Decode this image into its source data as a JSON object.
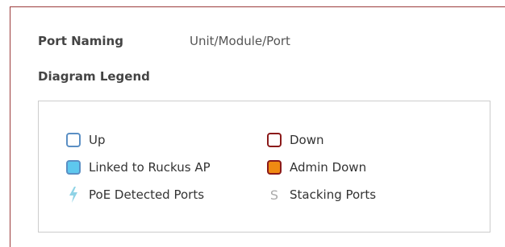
{
  "port_naming": {
    "label": "Port Naming",
    "value": "Unit/Module/Port"
  },
  "diagram_legend": {
    "title": "Diagram Legend",
    "items": [
      {
        "label": "Up",
        "icon": "up-swatch-icon",
        "color": "#ffffff",
        "border": "#5b8fc4"
      },
      {
        "label": "Down",
        "icon": "down-swatch-icon",
        "color": "#ffffff",
        "border": "#8b1a1a"
      },
      {
        "label": "Linked to Ruckus AP",
        "icon": "linked-swatch-icon",
        "color": "#5ec8ee",
        "border": "#5b8fc4"
      },
      {
        "label": "Admin Down",
        "icon": "admin-down-swatch-icon",
        "color": "#f08a12",
        "border": "#8b1a1a"
      },
      {
        "label": "PoE Detected Ports",
        "icon": "lightning-bolt-icon",
        "color": "#8fd3e6"
      },
      {
        "label": "Stacking Ports",
        "icon": "stacking-s-icon",
        "glyph": "S",
        "color": "#aaaaaa"
      }
    ]
  }
}
